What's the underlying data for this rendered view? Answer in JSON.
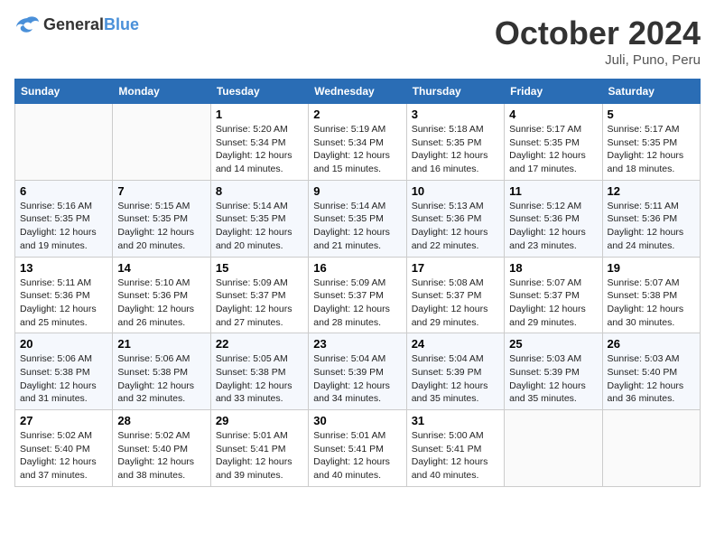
{
  "logo": {
    "general": "General",
    "blue": "Blue"
  },
  "title": "October 2024",
  "subtitle": "Juli, Puno, Peru",
  "days_of_week": [
    "Sunday",
    "Monday",
    "Tuesday",
    "Wednesday",
    "Thursday",
    "Friday",
    "Saturday"
  ],
  "weeks": [
    [
      {
        "day": "",
        "sunrise": "",
        "sunset": "",
        "daylight": ""
      },
      {
        "day": "",
        "sunrise": "",
        "sunset": "",
        "daylight": ""
      },
      {
        "day": "1",
        "sunrise": "Sunrise: 5:20 AM",
        "sunset": "Sunset: 5:34 PM",
        "daylight": "Daylight: 12 hours and 14 minutes."
      },
      {
        "day": "2",
        "sunrise": "Sunrise: 5:19 AM",
        "sunset": "Sunset: 5:34 PM",
        "daylight": "Daylight: 12 hours and 15 minutes."
      },
      {
        "day": "3",
        "sunrise": "Sunrise: 5:18 AM",
        "sunset": "Sunset: 5:35 PM",
        "daylight": "Daylight: 12 hours and 16 minutes."
      },
      {
        "day": "4",
        "sunrise": "Sunrise: 5:17 AM",
        "sunset": "Sunset: 5:35 PM",
        "daylight": "Daylight: 12 hours and 17 minutes."
      },
      {
        "day": "5",
        "sunrise": "Sunrise: 5:17 AM",
        "sunset": "Sunset: 5:35 PM",
        "daylight": "Daylight: 12 hours and 18 minutes."
      }
    ],
    [
      {
        "day": "6",
        "sunrise": "Sunrise: 5:16 AM",
        "sunset": "Sunset: 5:35 PM",
        "daylight": "Daylight: 12 hours and 19 minutes."
      },
      {
        "day": "7",
        "sunrise": "Sunrise: 5:15 AM",
        "sunset": "Sunset: 5:35 PM",
        "daylight": "Daylight: 12 hours and 20 minutes."
      },
      {
        "day": "8",
        "sunrise": "Sunrise: 5:14 AM",
        "sunset": "Sunset: 5:35 PM",
        "daylight": "Daylight: 12 hours and 20 minutes."
      },
      {
        "day": "9",
        "sunrise": "Sunrise: 5:14 AM",
        "sunset": "Sunset: 5:35 PM",
        "daylight": "Daylight: 12 hours and 21 minutes."
      },
      {
        "day": "10",
        "sunrise": "Sunrise: 5:13 AM",
        "sunset": "Sunset: 5:36 PM",
        "daylight": "Daylight: 12 hours and 22 minutes."
      },
      {
        "day": "11",
        "sunrise": "Sunrise: 5:12 AM",
        "sunset": "Sunset: 5:36 PM",
        "daylight": "Daylight: 12 hours and 23 minutes."
      },
      {
        "day": "12",
        "sunrise": "Sunrise: 5:11 AM",
        "sunset": "Sunset: 5:36 PM",
        "daylight": "Daylight: 12 hours and 24 minutes."
      }
    ],
    [
      {
        "day": "13",
        "sunrise": "Sunrise: 5:11 AM",
        "sunset": "Sunset: 5:36 PM",
        "daylight": "Daylight: 12 hours and 25 minutes."
      },
      {
        "day": "14",
        "sunrise": "Sunrise: 5:10 AM",
        "sunset": "Sunset: 5:36 PM",
        "daylight": "Daylight: 12 hours and 26 minutes."
      },
      {
        "day": "15",
        "sunrise": "Sunrise: 5:09 AM",
        "sunset": "Sunset: 5:37 PM",
        "daylight": "Daylight: 12 hours and 27 minutes."
      },
      {
        "day": "16",
        "sunrise": "Sunrise: 5:09 AM",
        "sunset": "Sunset: 5:37 PM",
        "daylight": "Daylight: 12 hours and 28 minutes."
      },
      {
        "day": "17",
        "sunrise": "Sunrise: 5:08 AM",
        "sunset": "Sunset: 5:37 PM",
        "daylight": "Daylight: 12 hours and 29 minutes."
      },
      {
        "day": "18",
        "sunrise": "Sunrise: 5:07 AM",
        "sunset": "Sunset: 5:37 PM",
        "daylight": "Daylight: 12 hours and 29 minutes."
      },
      {
        "day": "19",
        "sunrise": "Sunrise: 5:07 AM",
        "sunset": "Sunset: 5:38 PM",
        "daylight": "Daylight: 12 hours and 30 minutes."
      }
    ],
    [
      {
        "day": "20",
        "sunrise": "Sunrise: 5:06 AM",
        "sunset": "Sunset: 5:38 PM",
        "daylight": "Daylight: 12 hours and 31 minutes."
      },
      {
        "day": "21",
        "sunrise": "Sunrise: 5:06 AM",
        "sunset": "Sunset: 5:38 PM",
        "daylight": "Daylight: 12 hours and 32 minutes."
      },
      {
        "day": "22",
        "sunrise": "Sunrise: 5:05 AM",
        "sunset": "Sunset: 5:38 PM",
        "daylight": "Daylight: 12 hours and 33 minutes."
      },
      {
        "day": "23",
        "sunrise": "Sunrise: 5:04 AM",
        "sunset": "Sunset: 5:39 PM",
        "daylight": "Daylight: 12 hours and 34 minutes."
      },
      {
        "day": "24",
        "sunrise": "Sunrise: 5:04 AM",
        "sunset": "Sunset: 5:39 PM",
        "daylight": "Daylight: 12 hours and 35 minutes."
      },
      {
        "day": "25",
        "sunrise": "Sunrise: 5:03 AM",
        "sunset": "Sunset: 5:39 PM",
        "daylight": "Daylight: 12 hours and 35 minutes."
      },
      {
        "day": "26",
        "sunrise": "Sunrise: 5:03 AM",
        "sunset": "Sunset: 5:40 PM",
        "daylight": "Daylight: 12 hours and 36 minutes."
      }
    ],
    [
      {
        "day": "27",
        "sunrise": "Sunrise: 5:02 AM",
        "sunset": "Sunset: 5:40 PM",
        "daylight": "Daylight: 12 hours and 37 minutes."
      },
      {
        "day": "28",
        "sunrise": "Sunrise: 5:02 AM",
        "sunset": "Sunset: 5:40 PM",
        "daylight": "Daylight: 12 hours and 38 minutes."
      },
      {
        "day": "29",
        "sunrise": "Sunrise: 5:01 AM",
        "sunset": "Sunset: 5:41 PM",
        "daylight": "Daylight: 12 hours and 39 minutes."
      },
      {
        "day": "30",
        "sunrise": "Sunrise: 5:01 AM",
        "sunset": "Sunset: 5:41 PM",
        "daylight": "Daylight: 12 hours and 40 minutes."
      },
      {
        "day": "31",
        "sunrise": "Sunrise: 5:00 AM",
        "sunset": "Sunset: 5:41 PM",
        "daylight": "Daylight: 12 hours and 40 minutes."
      },
      {
        "day": "",
        "sunrise": "",
        "sunset": "",
        "daylight": ""
      },
      {
        "day": "",
        "sunrise": "",
        "sunset": "",
        "daylight": ""
      }
    ]
  ]
}
